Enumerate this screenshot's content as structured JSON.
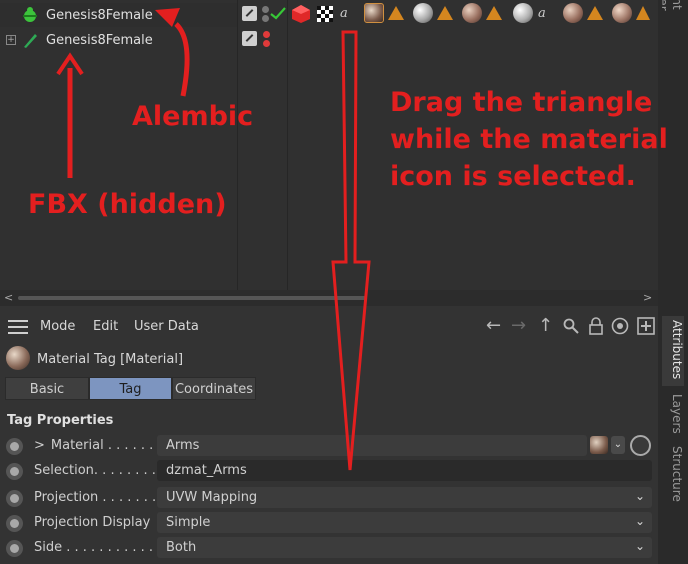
{
  "object_manager": {
    "rows": [
      {
        "name": "Genesis8Female",
        "selected": true,
        "icon": "figure-icon"
      },
      {
        "name": "Genesis8Female",
        "selected": false,
        "icon": "bone-icon",
        "expander": "+"
      }
    ]
  },
  "right_tabs": {
    "content_browser": "Content Browser",
    "attributes": "Attributes",
    "layers": "Layers",
    "structure": "Structure"
  },
  "attributes": {
    "menu": [
      "Mode",
      "Edit",
      "User Data"
    ],
    "header_title": "Material Tag [Material]",
    "tabs": [
      {
        "label": "Basic",
        "active": false
      },
      {
        "label": "Tag",
        "active": true
      },
      {
        "label": "Coordinates",
        "active": false
      }
    ],
    "section_title": "Tag Properties",
    "properties": [
      {
        "label": "Material . . . . . . .",
        "value": "Arms",
        "prefix": ">"
      },
      {
        "label": "Selection. . . . . . . .",
        "value": "dzmat_Arms"
      },
      {
        "label": "Projection . . . . . . .",
        "value": "UVW Mapping"
      },
      {
        "label": "Projection Display",
        "value": "Simple"
      },
      {
        "label": "Side . . . . . . . . . . . .",
        "value": "Both"
      }
    ]
  },
  "annotations": {
    "alembic": "Alembic",
    "fbx": "FBX (hidden)",
    "instruction_lines": [
      "Drag the triangle",
      "while the material",
      "icon is selected."
    ],
    "color": "#e31f1f"
  },
  "colors": {
    "accent_tab": "#7d95c0",
    "tag_triangle": "#d4861f",
    "annotation": "#e31f1f"
  }
}
